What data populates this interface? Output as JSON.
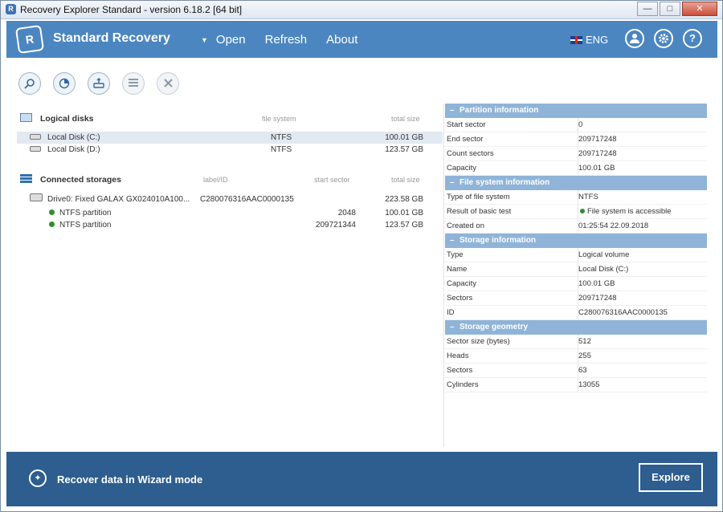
{
  "window": {
    "title": "Recovery Explorer Standard - version 6.18.2 [64 bit]",
    "minimize": "—",
    "maximize": "□",
    "close": "✕"
  },
  "header": {
    "brand": "Standard Recovery",
    "menu": [
      "Open",
      "Refresh",
      "About"
    ],
    "menu_dropdown": "▼",
    "language": "ENG"
  },
  "left": {
    "logical": {
      "title": "Logical disks",
      "col_fs": "file system",
      "col_size": "total size",
      "rows": [
        {
          "name": "Local Disk (C:)",
          "fs": "NTFS",
          "size": "100.01 GB"
        },
        {
          "name": "Local Disk (D:)",
          "fs": "NTFS",
          "size": "123.57 GB"
        }
      ]
    },
    "storages": {
      "title": "Connected storages",
      "col_label": "label/ID",
      "col_start": "start sector",
      "col_size": "total size",
      "drive": {
        "name": "Drive0: Fixed GALAX GX024010A100...",
        "id": "C280076316AAC0000135",
        "size": "223.58 GB"
      },
      "partitions": [
        {
          "name": "NTFS partition",
          "start": "2048",
          "size": "100.01 GB"
        },
        {
          "name": "NTFS partition",
          "start": "209721344",
          "size": "123.57 GB"
        }
      ]
    }
  },
  "right": {
    "partition": {
      "title": "Partition information",
      "rows": [
        {
          "k": "Start sector",
          "v": "0"
        },
        {
          "k": "End sector",
          "v": "209717248"
        },
        {
          "k": "Count sectors",
          "v": "209717248"
        },
        {
          "k": "Capacity",
          "v": "100.01 GB"
        }
      ]
    },
    "filesystem": {
      "title": "File system information",
      "rows": [
        {
          "k": "Type of file system",
          "v": "NTFS"
        },
        {
          "k": "Result of basic test",
          "v": "File system is accessible"
        },
        {
          "k": "Created on",
          "v": "01:25:54 22.09.2018"
        }
      ]
    },
    "storage": {
      "title": "Storage information",
      "rows": [
        {
          "k": "Type",
          "v": "Logical volume"
        },
        {
          "k": "Name",
          "v": "Local Disk (C:)"
        },
        {
          "k": "Capacity",
          "v": "100.01 GB"
        },
        {
          "k": "Sectors",
          "v": "209717248"
        },
        {
          "k": "ID",
          "v": "C280076316AAC0000135"
        }
      ]
    },
    "geometry": {
      "title": "Storage geometry",
      "rows": [
        {
          "k": "Sector size (bytes)",
          "v": "512"
        },
        {
          "k": "Heads",
          "v": "255"
        },
        {
          "k": "Sectors",
          "v": "63"
        },
        {
          "k": "Cylinders",
          "v": "13055"
        }
      ]
    }
  },
  "footer": {
    "wizard": "Recover data in Wizard mode",
    "explore": "Explore"
  },
  "colors": {
    "header": "#4b86c1",
    "footer": "#2d5e8f",
    "section": "#8fb4d8",
    "ok": "#2d8f2d"
  }
}
